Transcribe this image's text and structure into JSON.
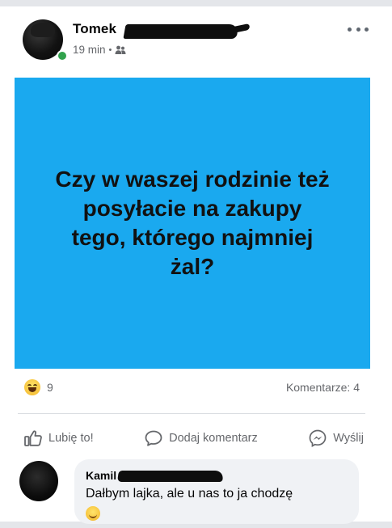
{
  "post": {
    "author_name": "Tomek",
    "timestamp": "19 min",
    "separator": "•",
    "audience_icon": "friends-icon",
    "more_icon": "more-options-icon",
    "image_text": "Czy w waszej rodzinie też posyłacie na zakupy tego, którego najmniej żal?",
    "image_bg_color": "#1aa9ef"
  },
  "stats": {
    "reaction_icon": "haha-reaction-icon",
    "reaction_count": "9",
    "comments_label": "Komentarze: 4"
  },
  "actions": {
    "like_label": "Lubię to!",
    "comment_label": "Dodaj komentarz",
    "share_label": "Wyślij"
  },
  "comment": {
    "author_name": "Kamil",
    "text": "Dałbym lajka, ale u nas to ja chodzę",
    "emoji": "smiling-emoji"
  }
}
